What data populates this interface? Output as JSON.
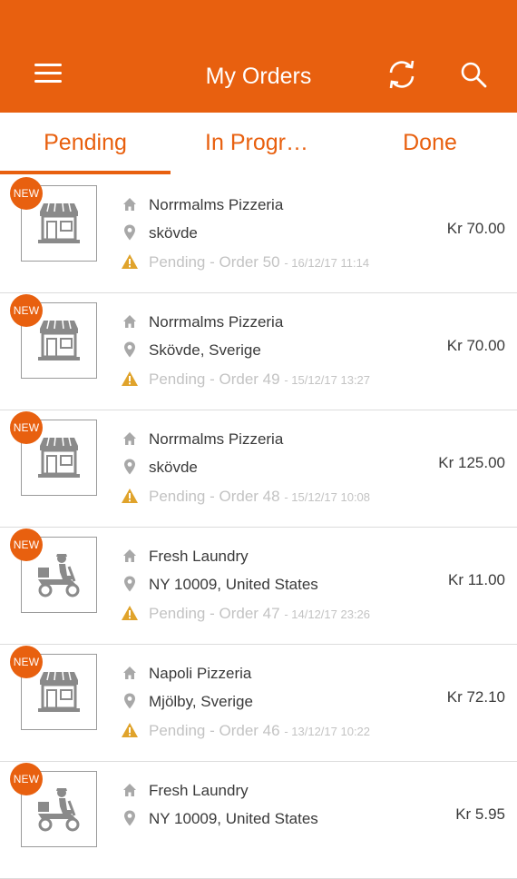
{
  "header": {
    "title": "My Orders",
    "background": "#e8600f",
    "icons": [
      "menu-icon",
      "refresh-icon",
      "search-icon"
    ]
  },
  "tabs": [
    {
      "label": "Pending",
      "active": true
    },
    {
      "label": "In Progr…",
      "active": false
    },
    {
      "label": "Done",
      "active": false
    }
  ],
  "orders": [
    {
      "badge": "NEW",
      "shop_icon": "storefront-icon",
      "name": "Norrmalms Pizzeria",
      "location": "skövde",
      "status": "Pending - Order 50",
      "date": "- 16/12/17 11:14",
      "price": "Kr 70.00"
    },
    {
      "badge": "NEW",
      "shop_icon": "storefront-icon",
      "name": "Norrmalms Pizzeria",
      "location": "Skövde, Sverige",
      "status": "Pending - Order 49",
      "date": "- 15/12/17 13:27",
      "price": "Kr 70.00"
    },
    {
      "badge": "NEW",
      "shop_icon": "storefront-icon",
      "name": "Norrmalms Pizzeria",
      "location": "skövde",
      "status": "Pending - Order 48",
      "date": "- 15/12/17 10:08",
      "price": "Kr 125.00"
    },
    {
      "badge": "NEW",
      "shop_icon": "delivery-scooter-icon",
      "name": "Fresh Laundry",
      "location": "NY 10009, United States",
      "status": "Pending - Order 47",
      "date": "- 14/12/17 23:26",
      "price": "Kr 11.00"
    },
    {
      "badge": "NEW",
      "shop_icon": "storefront-icon",
      "name": "Napoli Pizzeria",
      "location": "Mjölby, Sverige",
      "status": "Pending - Order 46",
      "date": "- 13/12/17 10:22",
      "price": "Kr 72.10"
    },
    {
      "badge": "NEW",
      "shop_icon": "delivery-scooter-icon",
      "name": "Fresh Laundry",
      "location": "NY 10009, United States",
      "status": "",
      "date": "",
      "price": "Kr 5.95"
    }
  ],
  "colors": {
    "accent": "#e8600f",
    "warning": "#e0a32b",
    "muted_text": "#c3c3c3",
    "icon_gray": "#a8a8a8"
  }
}
